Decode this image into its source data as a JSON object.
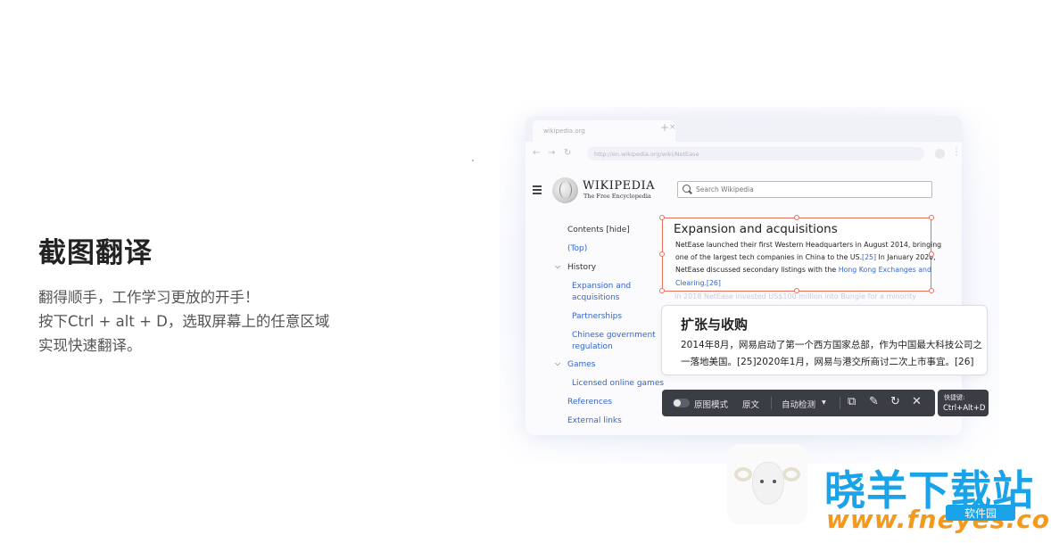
{
  "intro": {
    "title": "截图翻译",
    "lines": [
      "翻得顺手，工作学习更放的开手！",
      "按下Ctrl + alt + D，选取屏幕上的任意区域",
      "实现快速翻译。"
    ]
  },
  "browser": {
    "tab_title": "wikipedia.org",
    "tab_close": "×",
    "tab_add": "+",
    "url": "http://en.wikipedia.org/wiki/NetEase",
    "nav_back": "←",
    "nav_forward": "→",
    "nav_reload": "↻",
    "menu_kebab": "⋮"
  },
  "wiki": {
    "name": "WIKIPEDIA",
    "tagline": "The Free Encyclopedia",
    "search_placeholder": "Search Wikipedia",
    "toc": [
      {
        "label": "Contents [hide]"
      },
      {
        "label": "(Top)"
      },
      {
        "label": "History"
      },
      {
        "label": "Expansion and"
      },
      {
        "label": "acquisitions"
      },
      {
        "label": "Partnerships"
      },
      {
        "label": "Chinese government"
      },
      {
        "label": "regulation"
      },
      {
        "label": "Games"
      },
      {
        "label": "Licensed online games"
      },
      {
        "label": "References"
      },
      {
        "label": "External links"
      }
    ],
    "faded_line": "In 2018 NetEase invested US$100 million into Bungie for a minority"
  },
  "selection": {
    "title": "Expansion and acquisitions",
    "line1": "NetEase launched their first Western Headquarters in August 2014, bringing",
    "line2a": "one of the largest tech companies in China to the US.",
    "line2b": "[25]",
    "line2c": " In January 2020,",
    "line3a": "NetEase discussed secondary listings with the ",
    "line3b": "Hong Kong Exchanges and",
    "line4": "Clearing.[26]"
  },
  "translation": {
    "title": "扩张与收购",
    "line1": "2014年8月，网易启动了第一个西方国家总部，作为中国最大科技公司之",
    "line2": "一落地美国。[25]2020年1月，网易与港交所商讨二次上市事宜。[26]"
  },
  "toolbar": {
    "original_mode": "原图模式",
    "source_text": "原文",
    "auto_detect": "自动检测",
    "dropdown": "▾",
    "copy_icon": "⧉",
    "edit_icon": "✎",
    "retry_icon": "↻",
    "close_icon": "✕"
  },
  "shortcut": {
    "label": "快捷键:",
    "keys": "Ctrl+Alt+D"
  },
  "watermark": {
    "title": "晓羊下载站",
    "url": "www.fneyes.com",
    "badge": "软件园"
  }
}
